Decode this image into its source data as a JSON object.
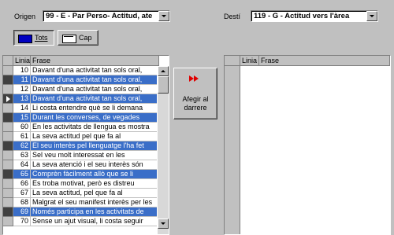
{
  "origen": {
    "label": "Origen",
    "value": "99 - E - Par Perso- Actitud, ate"
  },
  "desti": {
    "label": "Destí",
    "value": "119 - G - Actitud vers l'àrea"
  },
  "toolbar": {
    "tots_label": "Tots",
    "cap_label": "Cap"
  },
  "grid": {
    "col_linia": "Linia",
    "col_frase": "Frase",
    "rows": [
      {
        "num": "10",
        "text": "Davant d'una activitat tan sols oral,"
      },
      {
        "num": "11",
        "text": "Davant d'una activitat tan sols oral,"
      },
      {
        "num": "12",
        "text": "Davant d'una activitat tan sols oral,"
      },
      {
        "num": "13",
        "text": "Davant d'una activitat tan sols oral,"
      },
      {
        "num": "14",
        "text": "Li costa entendre què se li demana"
      },
      {
        "num": "15",
        "text": "Durant les converses, de vegades"
      },
      {
        "num": "60",
        "text": "En les activitats de llengua es mostra"
      },
      {
        "num": "61",
        "text": "La seva actitud pel que fa al"
      },
      {
        "num": "62",
        "text": "El seu interès pel llenguatge l'ha fet"
      },
      {
        "num": "63",
        "text": "Sel veu molt interessat en les"
      },
      {
        "num": "64",
        "text": "La seva atenció i el seu interès són"
      },
      {
        "num": "65",
        "text": "Comprèn fàcilment allò que se li"
      },
      {
        "num": "66",
        "text": "Es troba motivat, però es distreu"
      },
      {
        "num": "67",
        "text": "La seva actitud, pel que fa al"
      },
      {
        "num": "68",
        "text": "Malgrat el seu manifest interès per les"
      },
      {
        "num": "69",
        "text": "Només participa en les activitats de"
      },
      {
        "num": "70",
        "text": "Sense un ajut visual, li costa seguir"
      }
    ]
  },
  "right_grid": {
    "col_linia": "Linia",
    "col_frase": "Frase"
  },
  "add_button": {
    "label_line1": "Afegir al",
    "label_line2": "darrere"
  },
  "colors": {
    "selection": "#3a6ec8",
    "background": "#c0c0c0",
    "add_arrow": "#e00000"
  }
}
